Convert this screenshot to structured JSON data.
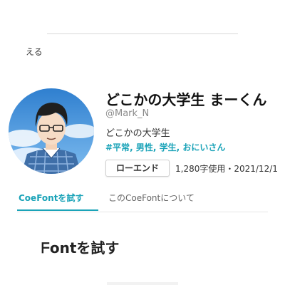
{
  "header": {
    "partial_text": "える"
  },
  "profile": {
    "display_name": "どこかの大学生 まーくん",
    "handle": "@Mark_N",
    "bio": "どこかの大学生",
    "tags": [
      "#平常",
      "男性",
      "学生",
      "おにいさん"
    ],
    "tag_separator": ", ",
    "quality_badge": "ローエンド",
    "meta": "1,280字使用・2021/12/1"
  },
  "tabs": [
    {
      "label": "CoeFontを試す",
      "active": true
    },
    {
      "label": "このCoeFontについて",
      "active": false
    }
  ],
  "section": {
    "heading": "ᖴontを試す"
  },
  "colors": {
    "accent": "#1aa3b8",
    "avatar_sky": "#3a8fd6",
    "shirt": "#3f6fa8"
  }
}
